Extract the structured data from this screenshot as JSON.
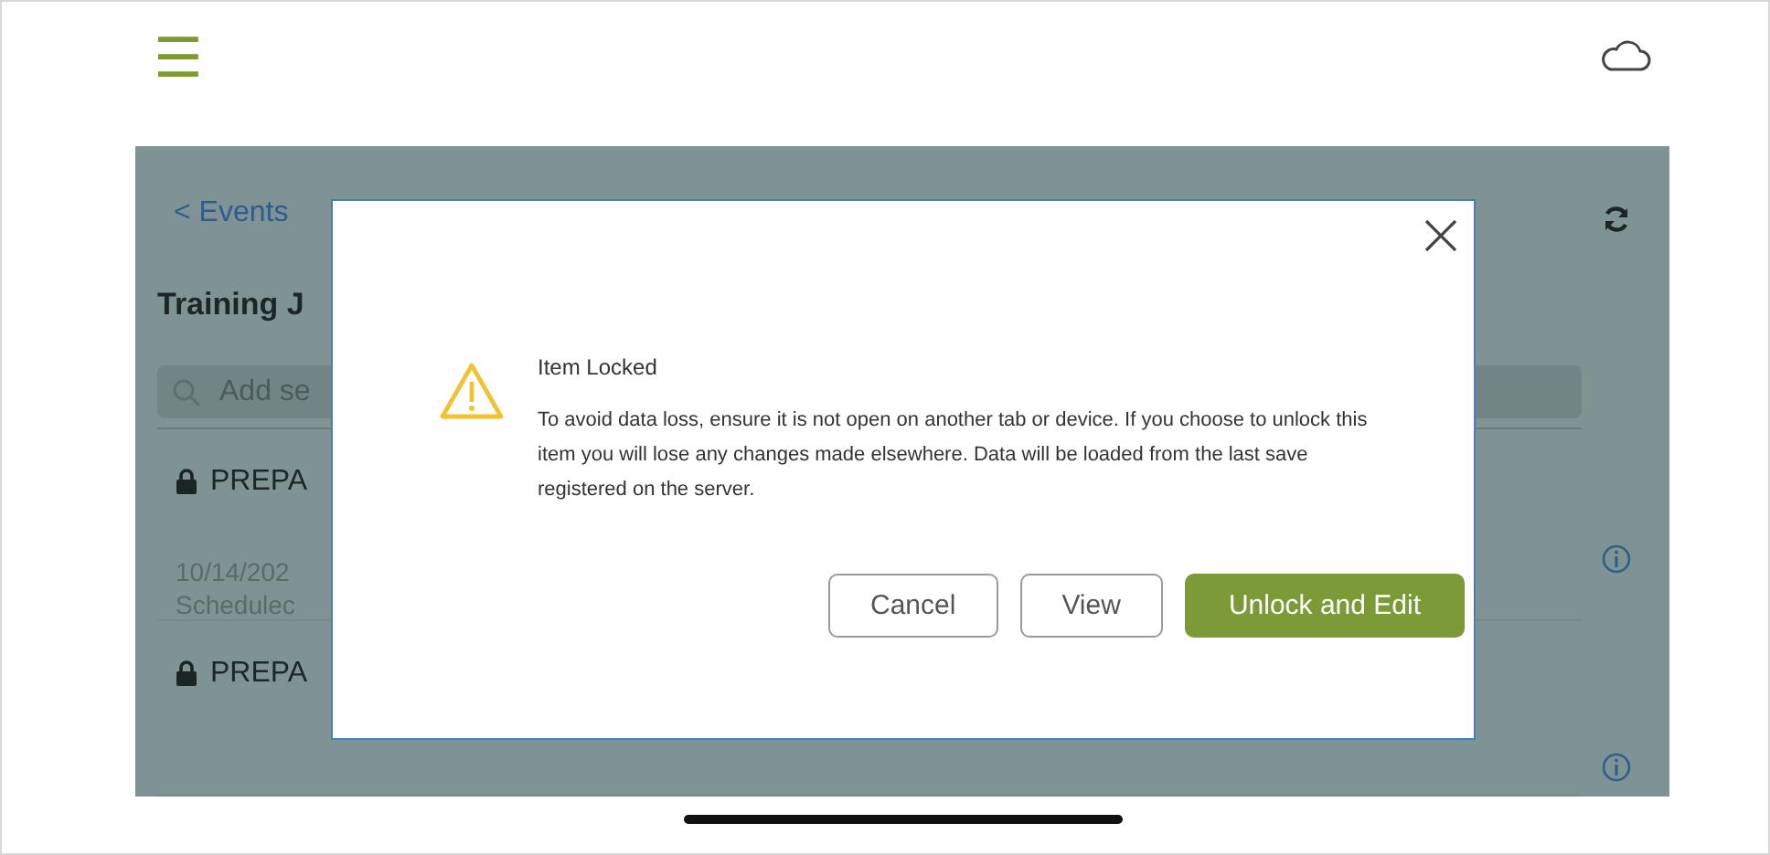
{
  "header": {
    "menu_glyph": "☰"
  },
  "page": {
    "back_link": "< Events",
    "title": "Training J",
    "search": {
      "placeholder": "Add se"
    },
    "events": [
      {
        "name": "PREPA",
        "date": "10/14/202",
        "status": "Schedulec",
        "locked": true
      },
      {
        "name": "PREPA",
        "locked": true
      }
    ]
  },
  "dialog": {
    "title": "Item Locked",
    "message": "To avoid data loss, ensure it is not open on another tab or device. If you choose to unlock this item you will lose any changes made elsewhere. Data will be loaded from the last save registered on the server.",
    "buttons": [
      {
        "label": "Cancel",
        "kind": "outline"
      },
      {
        "label": "View",
        "kind": "outline"
      },
      {
        "label": "Unlock and Edit",
        "kind": "primary"
      }
    ]
  }
}
